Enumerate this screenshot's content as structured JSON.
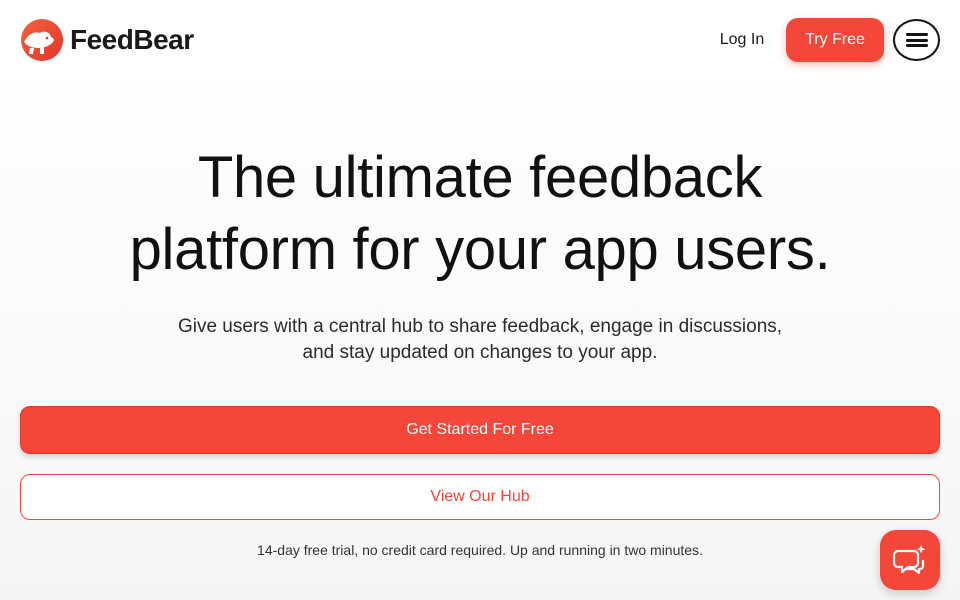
{
  "nav": {
    "brand": "FeedBear",
    "login_label": "Log In",
    "try_free_label": "Try Free",
    "menu_icon": "hamburger-icon"
  },
  "hero": {
    "headline_line1": "The ultimate feedback",
    "headline_line2": "platform for your app users.",
    "sub_line1": "Give users with a central hub to share feedback, engage in discussions,",
    "sub_line2": "and stay updated on changes to your app.",
    "primary_cta": "Get Started For Free",
    "secondary_cta": "View Our Hub",
    "note": "14-day free trial, no credit card required. Up and running in two minutes."
  },
  "chat": {
    "icon": "chat-bubble-icon"
  },
  "colors": {
    "accent": "#f4473a",
    "text": "#141414",
    "background": "#ffffff"
  }
}
